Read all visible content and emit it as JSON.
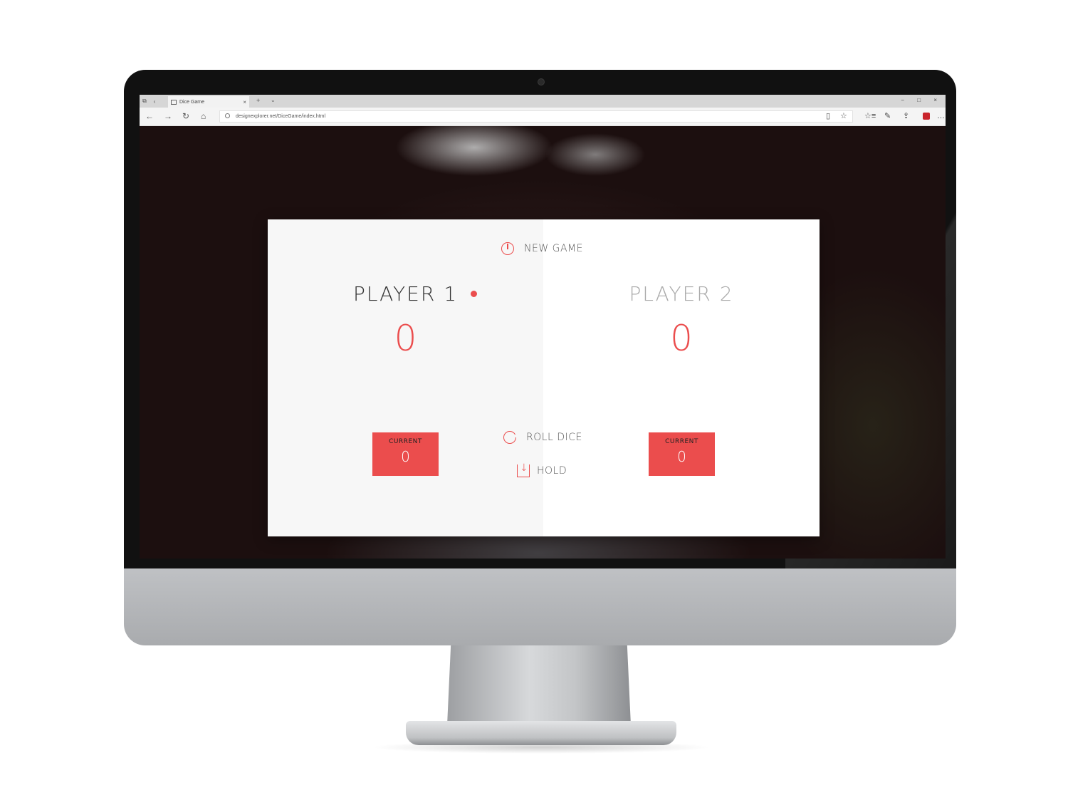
{
  "browser": {
    "tab_title": "Dice Game",
    "tab_close": "×",
    "new_tab": "+",
    "tab_list": "⌄",
    "window_controls": "− □ ×",
    "url": "designexplorer.net/DiceGame/index.html",
    "nav": {
      "back": "←",
      "forward": "→",
      "refresh": "↻",
      "home": "⌂"
    },
    "toolbar_icons": {
      "reading_view": "▯",
      "favorite": "☆",
      "favorites_hub": "☆≡",
      "pen": "✎",
      "share": "⇪",
      "more": "…"
    }
  },
  "game": {
    "new_game_label": "NEW GAME",
    "roll_dice_label": "ROLL DICE",
    "hold_label": "HOLD",
    "accent_color": "#eb4d4d",
    "players": [
      {
        "name": "PLAYER 1",
        "score": "0",
        "current_label": "CURRENT",
        "current_value": "0",
        "active": true
      },
      {
        "name": "PLAYER 2",
        "score": "0",
        "current_label": "CURRENT",
        "current_value": "0",
        "active": false
      }
    ]
  }
}
